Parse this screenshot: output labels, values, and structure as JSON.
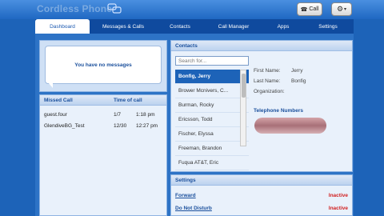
{
  "header": {
    "title": "Cordless Phone",
    "call_label": "Call",
    "logo_icon": "chat-bubbles-icon",
    "gear_icon": "gear-icon"
  },
  "nav": {
    "tabs": [
      {
        "label": "Dashboard",
        "active": true
      },
      {
        "label": "Messages & Calls"
      },
      {
        "label": "Contacts"
      },
      {
        "label": "Call Manager"
      },
      {
        "label": "Apps"
      },
      {
        "label": "Settings"
      }
    ]
  },
  "messages": {
    "empty_text": "You have no messages"
  },
  "missed": {
    "col_call": "Missed Call",
    "col_time": "Time of call",
    "rows": [
      {
        "name": "guest.four",
        "date": "1/7",
        "time": "1:18 pm"
      },
      {
        "name": "GlendiveBG_Test",
        "date": "12/30",
        "time": "12:27 pm"
      }
    ]
  },
  "contacts": {
    "title": "Contacts",
    "search_placeholder": "Search for...",
    "items": [
      "Bonfig, Jerry",
      "Brower Mcnivers, C...",
      "Burman, Rocky",
      "Ericsson, Todd",
      "Fischer, Elyssa",
      "Freeman, Brandon",
      "Fuqua AT&T, Eric"
    ],
    "detail": {
      "first_name_label": "First Name:",
      "first_name": "Jerry",
      "last_name_label": "Last Name:",
      "last_name": "Bonfig",
      "org_label": "Organization:",
      "phone_head": "Telephone Numbers"
    }
  },
  "settings": {
    "title": "Settings",
    "rows": [
      {
        "name": "Forward",
        "status": "Inactive"
      },
      {
        "name": "Do Not Disturb",
        "status": "Inactive"
      }
    ]
  },
  "colors": {
    "accent": "#1d63b8",
    "status_inactive": "#d11f1f"
  }
}
